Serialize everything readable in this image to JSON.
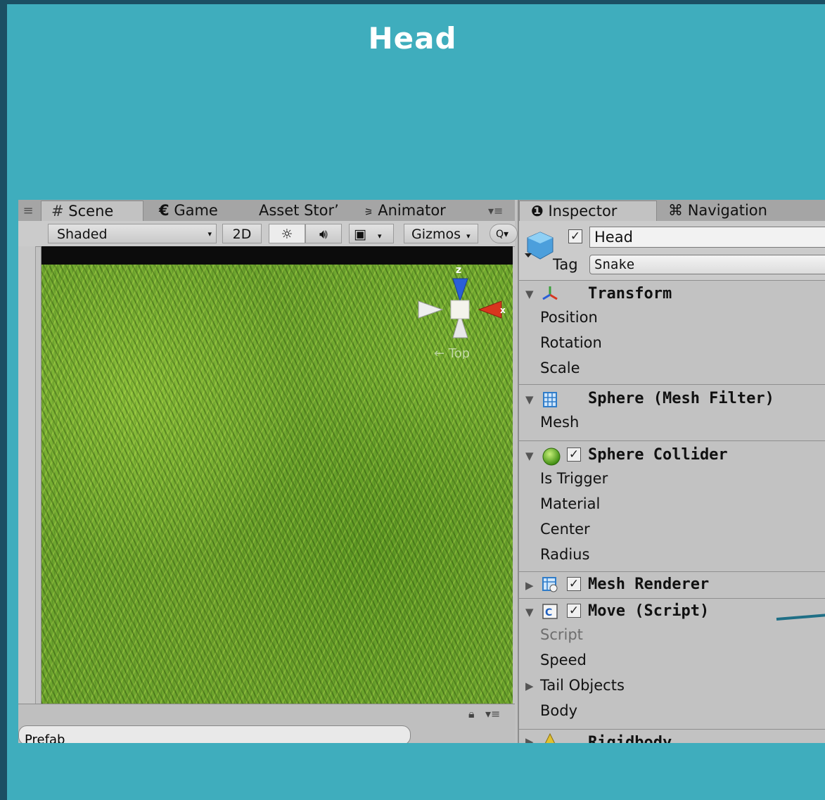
{
  "slide": {
    "title": "Head"
  },
  "scene_panel": {
    "tabs": [
      "Scene",
      "Game",
      "Asset Stor’",
      "Animator"
    ],
    "toolbar": {
      "shading": "Shaded",
      "mode_2d": "2D",
      "gizmos": "Gizmos"
    },
    "gizmo": {
      "z_label": "z",
      "x_label": "x",
      "view_label": "← Top"
    },
    "bottom_field": "Prefab"
  },
  "inspector": {
    "tabs": [
      "Inspector",
      "Navigation"
    ],
    "object_name": "Head",
    "active_checked": true,
    "tag_label": "Tag",
    "tag_value": "Snake",
    "components": [
      {
        "title": "Transform",
        "expanded": true,
        "icon": "transform-icon",
        "fields": [
          "Position",
          "Rotation",
          "Scale"
        ]
      },
      {
        "title": "Sphere (Mesh Filter)",
        "expanded": true,
        "icon": "mesh-filter-icon",
        "fields": [
          "Mesh"
        ]
      },
      {
        "title": "Sphere Collider",
        "expanded": true,
        "icon": "sphere-collider-icon",
        "checked": true,
        "fields": [
          "Is Trigger",
          "Material",
          "Center",
          "Radius"
        ]
      },
      {
        "title": "Mesh Renderer",
        "expanded": false,
        "icon": "mesh-renderer-icon",
        "checked": true,
        "fields": []
      },
      {
        "title": "Move (Script)",
        "expanded": true,
        "icon": "script-icon",
        "checked": true,
        "fields": [
          "Script",
          "Speed",
          "Tail Objects",
          "Body"
        ]
      },
      {
        "title": "Rigidbody",
        "expanded": false,
        "icon": "rigidbody-icon",
        "fields": []
      }
    ]
  },
  "colors": {
    "slide_bg": "#3fadbd",
    "frame": "#1b4f63",
    "panel": "#c2c2c2",
    "callout": "#1f6f86"
  }
}
